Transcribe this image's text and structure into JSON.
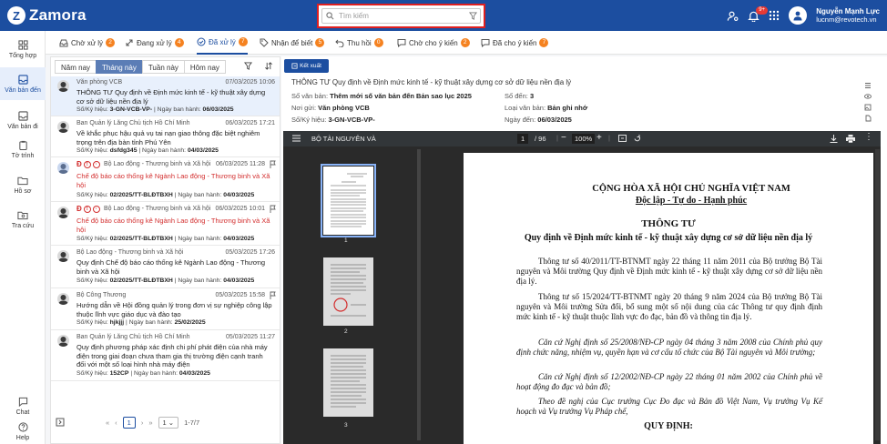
{
  "header": {
    "app_name": "Zamora",
    "search_placeholder": "Tìm kiếm",
    "notification_count": "9+",
    "user_name": "Nguyễn Mạnh Lực",
    "user_email": "lucnm@revotech.vn"
  },
  "sidebar": {
    "items": [
      {
        "label": "Tổng hợp",
        "icon": "dashboard-icon"
      },
      {
        "label": "Văn bản đến",
        "icon": "inbox-icon",
        "active": true
      },
      {
        "label": "Văn bản đi",
        "icon": "outbox-icon"
      },
      {
        "label": "Tờ trình",
        "icon": "clipboard-icon"
      },
      {
        "label": "Hồ sơ",
        "icon": "folder-icon"
      },
      {
        "label": "Tra cứu",
        "icon": "search-folder-icon"
      }
    ],
    "chat_label": "Chat",
    "help_label": "Help"
  },
  "tabs": [
    {
      "label": "Chờ xử lý",
      "count": "2"
    },
    {
      "label": "Đang xử lý",
      "count": "4"
    },
    {
      "label": "Đã xử lý",
      "count": "7",
      "active": true
    },
    {
      "label": "Nhận để biết",
      "count": "5"
    },
    {
      "label": "Thu hồi",
      "count": "0"
    },
    {
      "label": "Chờ cho ý kiến",
      "count": "2"
    },
    {
      "label": "Đã cho ý kiến",
      "count": "7"
    }
  ],
  "list": {
    "periods": [
      "Năm nay",
      "Tháng này",
      "Tuần này",
      "Hôm nay"
    ],
    "active_period": "Tháng này",
    "items": [
      {
        "sender": "Văn phòng VCB",
        "date": "07/03/2025 10:06",
        "title": "THÔNG TƯ Quy định về Định mức kinh tế - kỹ thuật xây dựng cơ sở dữ liệu nền địa lý",
        "number": "3-GN-VCB-VP-",
        "issued": "06/03/2025",
        "selected": true
      },
      {
        "sender": "Ban Quản lý Lăng Chủ tịch Hồ Chí Minh",
        "date": "06/03/2025 17:21",
        "title": "Về khắc phục hậu quả vụ tai nạn giao thông đặc biệt nghiêm trọng trên địa bàn tỉnh Phú Yên",
        "number": "dsfdg345",
        "issued": "04/03/2025"
      },
      {
        "sender": "Bộ Lao động - Thương binh và Xã hội",
        "date": "06/03/2025 11:28",
        "title": "Chế độ báo cáo thống kê Ngành Lao động - Thương binh và Xã hội",
        "number": "02/2025/TT-BLĐTBXH",
        "issued": "04/03/2025",
        "red": true
      },
      {
        "sender": "Bộ Lao động - Thương binh và Xã hội",
        "date": "06/03/2025 10:01",
        "title": "Chế độ báo cáo thống kê Ngành Lao động - Thương binh và Xã hội",
        "number": "02/2025/TT-BLĐTBXH",
        "issued": "04/03/2025",
        "red": true
      },
      {
        "sender": "Bộ Lao động - Thương binh và Xã hội",
        "date": "05/03/2025 17:26",
        "title": "Quy định Chế độ báo cáo thống kê Ngành Lao động - Thương binh và Xã hội",
        "number": "02/2025/TT-BLĐTBXH",
        "issued": "04/03/2025"
      },
      {
        "sender": "Bộ Công Thương",
        "date": "05/03/2025 15:58",
        "title": "Hướng dẫn về Hội đồng quản lý trong đơn vị sự nghiệp công lập thuộc lĩnh vực giáo dục và đào tạo",
        "number": "hjkjjj",
        "issued": "25/02/2025"
      },
      {
        "sender": "Ban Quản lý Lăng Chủ tịch Hồ Chí Minh",
        "date": "05/03/2025 11:27",
        "title": "Quy định phương pháp xác định chi phí phát điện của nhà máy điện trong giai đoạn chưa tham gia thị trường điện cạnh tranh đối với một số loại hình nhà máy điện",
        "number": "152CP",
        "issued": "04/03/2025"
      }
    ],
    "number_label": "Số/Ký hiệu:",
    "issued_label": "Ngày ban hành:",
    "pager": {
      "page": "1",
      "page_size": "1",
      "range": "1-7/7"
    }
  },
  "detail": {
    "export_label": "Kết xuất",
    "title": "THÔNG TƯ Quy định về Định mức kinh tế - kỹ thuật xây dựng cơ sở dữ liệu nền địa lý",
    "rows": {
      "so_van_ban_label": "Số văn bản:",
      "so_van_ban": "Thêm mới số văn bản đến Bản sao lục 2025",
      "so_den_label": "Số đến:",
      "so_den": "3",
      "noi_gui_label": "Nơi gửi:",
      "noi_gui": "Văn phòng VCB",
      "loai_label": "Loại văn bản:",
      "loai": "Bản ghi nhớ",
      "ky_hieu_label": "Số/Ký hiệu:",
      "ky_hieu": "3-GN-VCB-VP-",
      "ngay_den_label": "Ngày đến:",
      "ngay_den": "06/03/2025"
    }
  },
  "viewer": {
    "doc_name": "BỘ TÀI NGUYÊN VÀ",
    "page_current": "1",
    "page_total": "/ 96",
    "zoom": "100%",
    "thumb_labels": [
      "1",
      "2",
      "3"
    ],
    "page": {
      "header1": "CỘNG HÒA XÃ HỘI CHỦ NGHĨA VIỆT NAM",
      "header2": "Độc lập - Tự do - Hạnh phúc",
      "doc_type": "THÔNG TƯ",
      "doc_title": "Quy định về Định mức kinh tế - kỹ thuật xây dựng cơ sở dữ liệu nền địa lý",
      "p1": "Thông tư số 40/2011/TT-BTNMT ngày 22 tháng 11 năm 2011 của Bộ trưởng Bộ Tài nguyên và Môi trường Quy định về Định mức kinh tế - kỹ thuật xây dựng cơ sở dữ liệu nền địa lý.",
      "p2": "Thông tư số 15/2024/TT-BTNMT ngày 20 tháng 9 năm 2024 của Bộ trưởng Bộ Tài nguyên và Môi trường Sửa đổi, bổ sung một số nội dung của các Thông tư quy định định mức kinh tế - kỹ thuật thuộc lĩnh vực đo đạc, bản đồ và thông tin địa lý.",
      "p3": "Căn cứ Nghị định số 25/2008/NĐ-CP ngày 04 tháng 3 năm 2008 của Chính phủ quy định chức năng, nhiệm vụ, quyền hạn và cơ cấu tổ chức của Bộ Tài nguyên và Môi trường;",
      "p4": "Căn cứ Nghị định số 12/2002/NĐ-CP ngày 22 tháng 01 năm 2002 của Chính phủ về hoạt động đo đạc và bản đồ;",
      "p5": "Theo đề nghị của Cục trưởng Cục Đo đạc và Bản đồ Việt Nam, Vụ trưởng Vụ Kế hoạch và Vụ trưởng Vụ Pháp chế,",
      "section": "QUY ĐỊNH:"
    }
  },
  "colors": {
    "primary": "#1c4ea0",
    "badge": "#f58220",
    "alert": "#d32f2f"
  }
}
